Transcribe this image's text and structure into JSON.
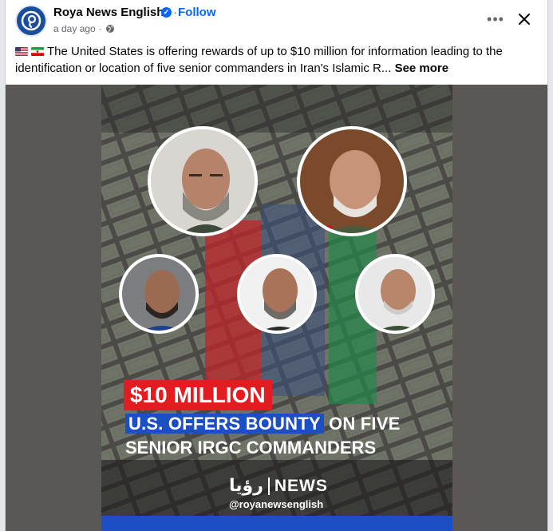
{
  "post": {
    "page_name": "Roya News English",
    "follow_label": "Follow",
    "separator": "·",
    "time_ago": "a day ago",
    "time_separator": "·",
    "caption_text": "The United States is offering rewards of up to $10 million for information leading to the identification or location of five senior commanders in Iran's Islamic R...",
    "see_more_label": "See more",
    "more_options_label": "•••"
  },
  "poster": {
    "amount": "$10 MILLION",
    "line2_highlight": "U.S. OFFERS BOUNTY",
    "line2_rest": " ON FIVE",
    "line3": "SENIOR IRGC COMMANDERS",
    "logo_mark": "رؤيا",
    "logo_text": "NEWS",
    "handle": "@royanewsenglish"
  },
  "colors": {
    "accent": "#0866ff",
    "headline_red": "#e21c21",
    "headline_blue": "#1d4fc4"
  },
  "icons": {
    "avatar": "roya-logo-icon",
    "verified": "verified-badge-icon",
    "audience": "globe-icon",
    "more": "more-options-icon",
    "close": "close-icon",
    "flags": [
      "us-flag-icon",
      "iran-flag-icon"
    ]
  }
}
